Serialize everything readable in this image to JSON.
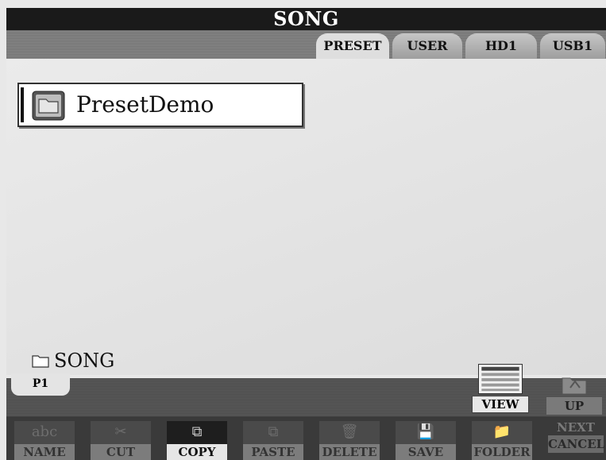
{
  "title": "SONG",
  "tabs": [
    {
      "label": "PRESET",
      "active": true
    },
    {
      "label": "USER",
      "active": false
    },
    {
      "label": "HD1",
      "active": false
    },
    {
      "label": "USB1",
      "active": false
    }
  ],
  "files": [
    {
      "name": "PresetDemo",
      "icon": "folder-icon"
    }
  ],
  "current_path": "SONG",
  "page_tab": "P1",
  "view_button": "VIEW",
  "up_button": "UP",
  "functions": [
    {
      "label": "NAME",
      "icon": "abc",
      "enabled": false
    },
    {
      "label": "CUT",
      "icon": "✂",
      "enabled": false
    },
    {
      "label": "COPY",
      "icon": "⧉",
      "enabled": true
    },
    {
      "label": "PASTE",
      "icon": "⧉",
      "enabled": false
    },
    {
      "label": "DELETE",
      "icon": "🗑",
      "enabled": false
    },
    {
      "label": "SAVE",
      "icon": "💾",
      "enabled": false
    },
    {
      "label": "FOLDER",
      "icon": "📁",
      "enabled": false
    }
  ],
  "next_label": "NEXT",
  "cancel_label": "CANCEL"
}
